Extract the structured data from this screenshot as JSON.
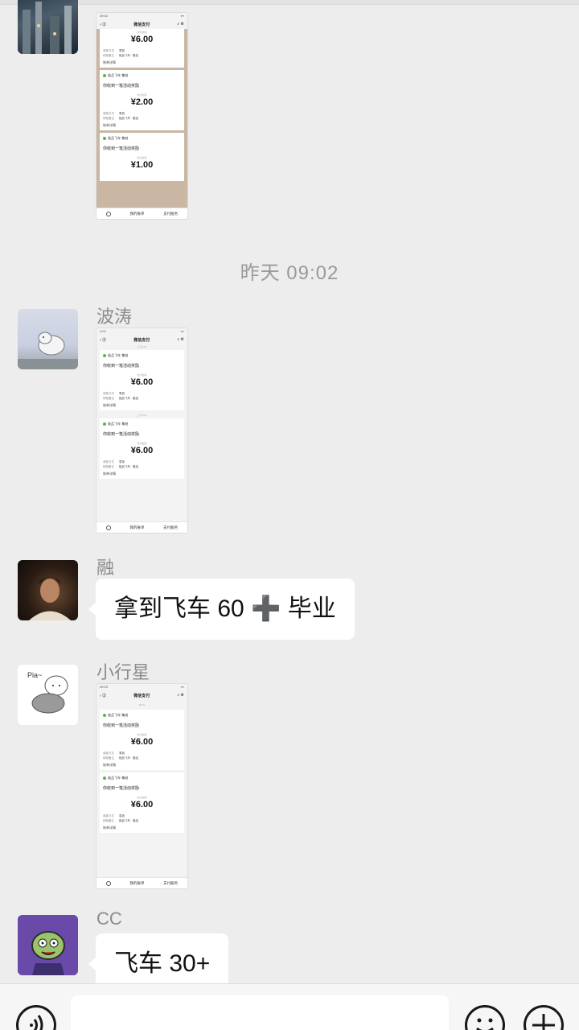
{
  "screenshot_a": {
    "cards": [
      {
        "amount": "¥6.00",
        "has_head": false
      },
      {
        "head": "极品飞车·集结",
        "desc": "你收到一笔活动奖励",
        "label": "收款金额",
        "amount": "¥2.00",
        "row1_k": "收款方式",
        "row1_v": "零钱",
        "row2_k": "转账备注",
        "row2_v": "极品飞车 · 集结",
        "foot": "账单详情"
      },
      {
        "head": "极品飞车·集结",
        "desc": "你收到一笔活动奖励",
        "label": "收款金额",
        "amount": "¥1.00"
      }
    ],
    "title": "微信支付",
    "status": "09:02",
    "nav_left": "我的账单",
    "nav_right": "支付服务",
    "pre_row1_k": "收款方式",
    "pre_row1_v": "零钱",
    "pre_row2_k": "转账备注",
    "pre_row2_v": "极品飞车 · 集结",
    "pre_foot": "账单详情",
    "pre_label": "收款金额"
  },
  "timestamp": "昨天 09:02",
  "messages": [
    {
      "sender": "波涛",
      "shot": {
        "status": "9:02",
        "title": "微信支付",
        "date1": "上午9:04",
        "date2": "上午9:04",
        "cards": [
          {
            "head": "极品飞车·集结",
            "desc": "你收到一笔活动奖励",
            "label": "收款金额",
            "amount": "¥6.00",
            "row1_k": "收款方式",
            "row1_v": "零钱",
            "row2_k": "转账备注",
            "row2_v": "极品飞车 · 集结",
            "foot": "账单详情"
          },
          {
            "head": "极品飞车·集结",
            "desc": "你收到一笔活动奖励",
            "label": "收款金额",
            "amount": "¥6.00",
            "row1_k": "收款方式",
            "row1_v": "零钱",
            "row2_k": "转账备注",
            "row2_v": "极品飞车 · 集结",
            "foot": "账单详情"
          }
        ],
        "nav_left": "我的账单",
        "nav_right": "支付服务"
      }
    },
    {
      "sender": "融",
      "text": "拿到飞车 60 ➕ 毕业"
    },
    {
      "sender": "小行星",
      "shot": {
        "status": "09:03",
        "title": "微信支付",
        "date1": "09:01",
        "cards": [
          {
            "head": "极品飞车·集结",
            "desc": "你收到一笔活动奖励",
            "label": "收款金额",
            "amount": "¥6.00",
            "row1_k": "收款方式",
            "row1_v": "零钱",
            "row2_k": "转账备注",
            "row2_v": "极品飞车 · 集结",
            "foot": "账单详情"
          },
          {
            "head": "极品飞车·集结",
            "desc": "你收到一笔活动奖励",
            "label": "收款金额",
            "amount": "¥6.00",
            "row1_k": "收款方式",
            "row1_v": "零钱",
            "row2_k": "转账备注",
            "row2_v": "极品飞车 · 集结",
            "foot": "账单详情"
          }
        ],
        "nav_left": "我的账单",
        "nav_right": "支付服务"
      }
    },
    {
      "sender": "CC",
      "text": "飞车 30+"
    }
  ],
  "sticker_text": "Pia~",
  "icons": {
    "voice": "voice-icon",
    "emoji": "emoji-icon",
    "plus": "plus-icon"
  },
  "colors": {
    "background": "#ededed",
    "bubble": "#ffffff",
    "pay_green": "#59b54b"
  }
}
